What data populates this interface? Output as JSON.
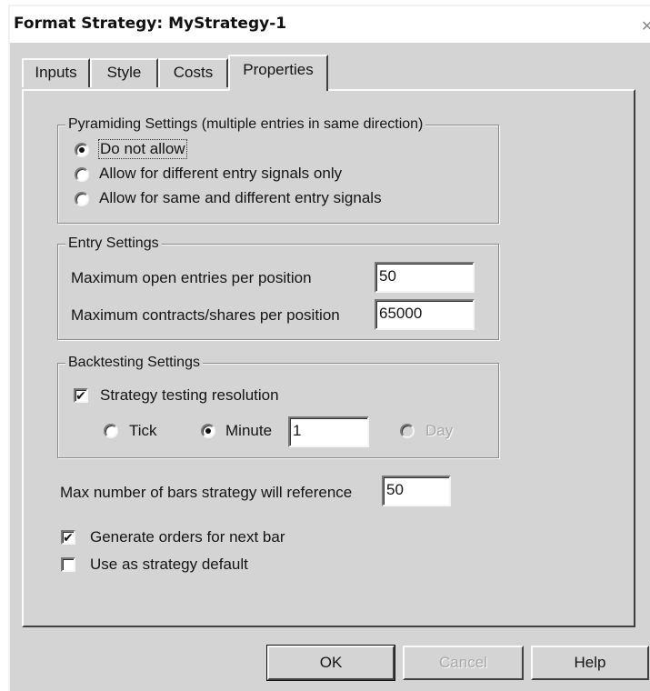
{
  "window": {
    "title": "Format Strategy: MyStrategy-1",
    "close_glyph": "✕"
  },
  "tabs": [
    {
      "label": "Inputs",
      "active": false
    },
    {
      "label": "Style",
      "active": false
    },
    {
      "label": "Costs",
      "active": false
    },
    {
      "label": "Properties",
      "active": true
    }
  ],
  "pyramiding": {
    "legend": "Pyramiding Settings (multiple entries in same direction)",
    "options": [
      {
        "label": "Do not allow",
        "selected": true
      },
      {
        "label": "Allow for different entry signals only",
        "selected": false
      },
      {
        "label": "Allow for same and different entry signals",
        "selected": false
      }
    ]
  },
  "entry": {
    "legend": "Entry Settings",
    "max_entries_label": "Maximum open entries per position",
    "max_entries_value": "50",
    "max_contracts_label": "Maximum contracts/shares per position",
    "max_contracts_value": "65000"
  },
  "backtesting": {
    "legend": "Backtesting Settings",
    "resolution_label": "Strategy testing resolution",
    "resolution_checked": true,
    "tick_label": "Tick",
    "minute_label": "Minute",
    "minute_value": "1",
    "day_label": "Day",
    "selected": "Minute"
  },
  "max_bars": {
    "label": "Max number of bars strategy will reference",
    "value": "50"
  },
  "generate_orders": {
    "label": "Generate orders for next bar",
    "checked": true
  },
  "strategy_default": {
    "label": "Use as strategy default",
    "checked": false
  },
  "buttons": {
    "ok": "OK",
    "cancel": "Cancel",
    "help": "Help"
  },
  "check_glyph": "✔"
}
